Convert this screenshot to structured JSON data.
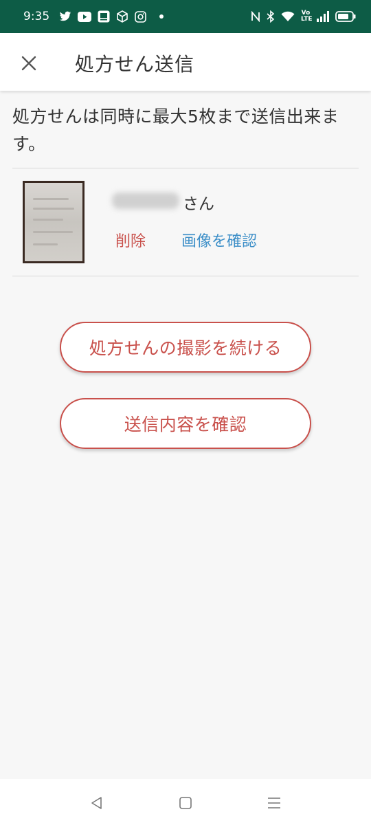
{
  "status_bar": {
    "time": "9:35",
    "left_icons": [
      "twitter-icon",
      "youtube-icon",
      "app-icon",
      "box-icon",
      "instagram-icon",
      "dot-icon"
    ],
    "right_icons": [
      "nfc-icon",
      "bluetooth-icon",
      "wifi-icon",
      "volte-icon",
      "signal-icon",
      "battery-icon"
    ],
    "volte_label": "Vo LTE",
    "background": "#0d5c46"
  },
  "app_bar": {
    "title": "処方せん送信",
    "close_icon": "close-icon"
  },
  "notice": "処方せんは同時に最大5枚まで送信出来ます。",
  "prescription_item": {
    "name_suffix": "さん",
    "delete_label": "削除",
    "view_label": "画像を確認"
  },
  "buttons": {
    "continue_label": "処方せんの撮影を続ける",
    "confirm_label": "送信内容を確認"
  },
  "colors": {
    "accent_red": "#c9514c",
    "link_blue": "#3d8fc8"
  },
  "nav_bar": {
    "icons": [
      "back-icon",
      "home-icon",
      "menu-icon"
    ]
  }
}
